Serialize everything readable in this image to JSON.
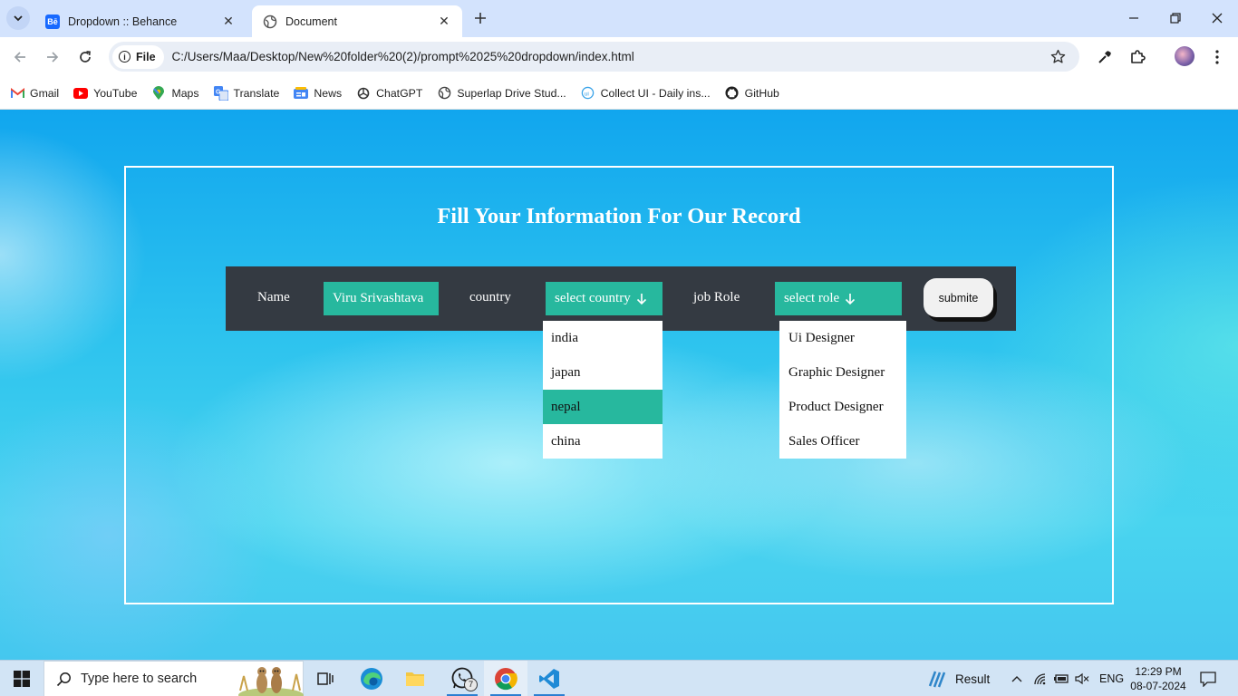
{
  "browser": {
    "tabs": [
      {
        "title": "Dropdown :: Behance",
        "favicon": "behance-icon",
        "active": false
      },
      {
        "title": "Document",
        "favicon": "globe-icon",
        "active": true
      }
    ],
    "address": {
      "scheme_chip": "File",
      "url": "C:/Users/Maa/Desktop/New%20folder%20(2)/prompt%2025%20dropdown/index.html"
    },
    "bookmarks": [
      {
        "label": "Gmail",
        "icon": "gmail-icon"
      },
      {
        "label": "YouTube",
        "icon": "youtube-icon"
      },
      {
        "label": "Maps",
        "icon": "maps-icon"
      },
      {
        "label": "Translate",
        "icon": "translate-icon"
      },
      {
        "label": "News",
        "icon": "news-icon"
      },
      {
        "label": "ChatGPT",
        "icon": "chatgpt-icon"
      },
      {
        "label": "Superlap Drive Stud...",
        "icon": "globe-icon"
      },
      {
        "label": "Collect UI - Daily ins...",
        "icon": "collectui-icon"
      },
      {
        "label": "GitHub",
        "icon": "github-icon"
      }
    ]
  },
  "form": {
    "heading": "Fill Your Information For Our Record",
    "name_label": "Name",
    "name_value": "Viru Srivashtava",
    "country_label": "country",
    "country_select": "select country",
    "role_label": "job Role",
    "role_select": "select role",
    "submit_label": "submite",
    "countries": [
      "india",
      "japan",
      "nepal",
      "china"
    ],
    "highlighted_country": "nepal",
    "roles": [
      "Ui Designer",
      "Graphic Designer",
      "Product Designer",
      "Sales Officer"
    ],
    "accent_color": "#27b89e",
    "bar_color": "#343a42"
  },
  "taskbar": {
    "search_placeholder": "Type here to search",
    "whatsapp_badge": "7",
    "weather_label": "Result",
    "language": "ENG",
    "time": "12:29 PM",
    "date": "08-07-2024"
  }
}
